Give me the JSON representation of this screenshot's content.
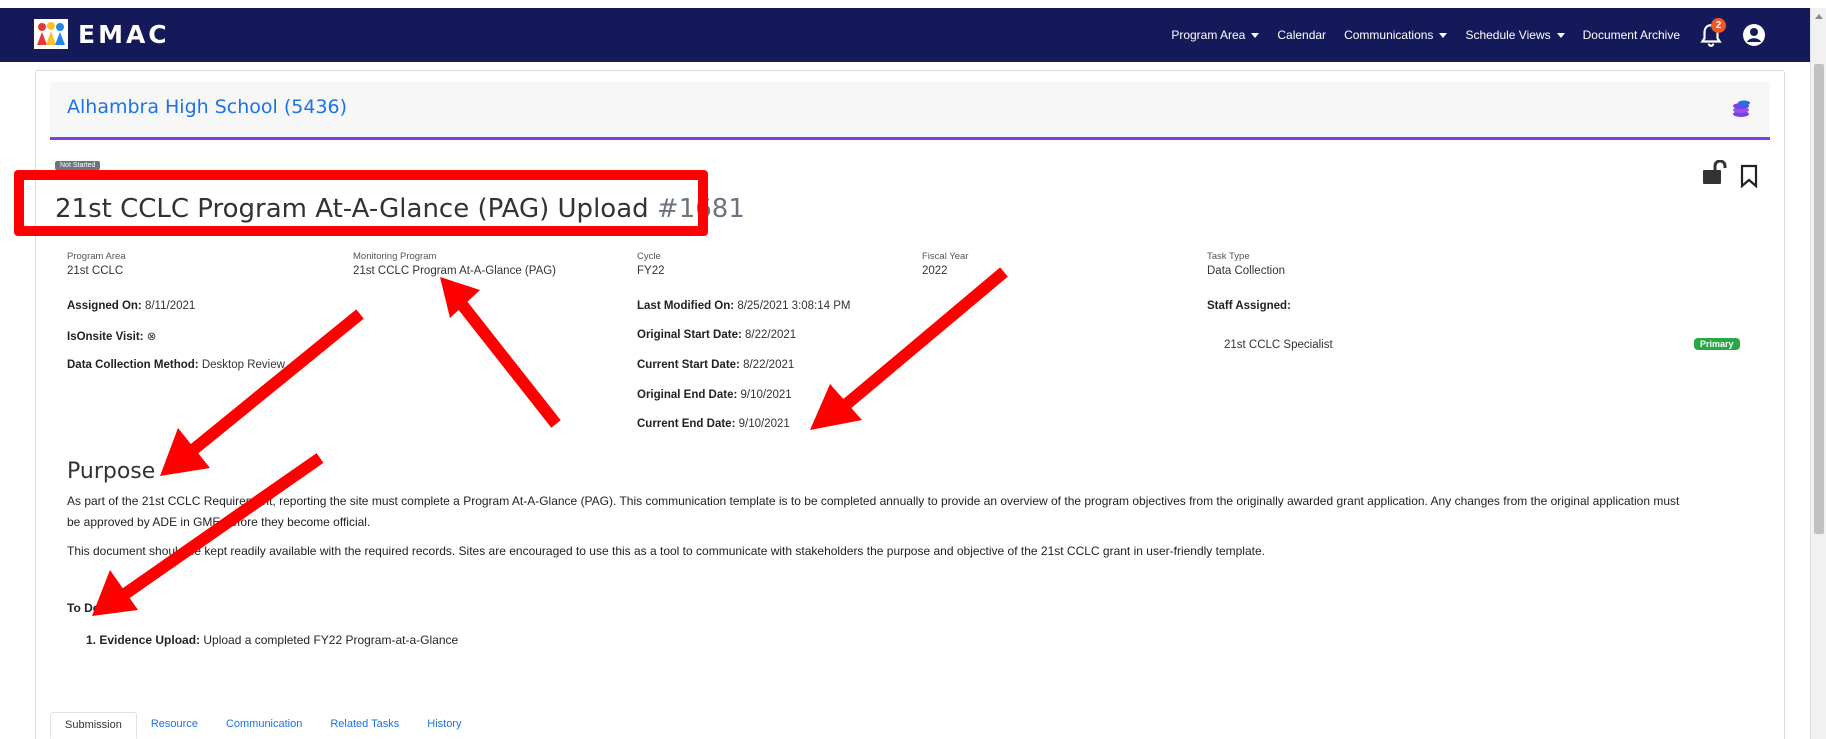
{
  "app": {
    "name": "EMAC"
  },
  "nav": {
    "items": [
      {
        "label": "Program Area",
        "dropdown": true
      },
      {
        "label": "Calendar",
        "dropdown": false
      },
      {
        "label": "Communications",
        "dropdown": true
      },
      {
        "label": "Schedule Views",
        "dropdown": true
      },
      {
        "label": "Document Archive",
        "dropdown": false
      }
    ],
    "notification_count": "2"
  },
  "school": {
    "name": "Alhambra High School (5436)"
  },
  "task": {
    "status": "Not Started",
    "title": "21st CCLC Program At-A-Glance (PAG) Upload",
    "number": "#1681"
  },
  "meta": {
    "program_area_label": "Program Area",
    "program_area": "21st CCLC",
    "monitoring_program_label": "Monitoring Program",
    "monitoring_program": "21st CCLC Program At-A-Glance (PAG)",
    "cycle_label": "Cycle",
    "cycle": "FY22",
    "fiscal_year_label": "Fiscal Year",
    "fiscal_year": "2022",
    "task_type_label": "Task Type",
    "task_type": "Data Collection"
  },
  "details": {
    "assigned_on_label": "Assigned On:",
    "assigned_on": "8/11/2021",
    "onsite_label": "IsOnsite Visit:",
    "onsite_value": "⊗",
    "method_label": "Data Collection Method:",
    "method": "Desktop Review",
    "last_modified_label": "Last Modified On:",
    "last_modified": "8/25/2021 3:08:14 PM",
    "orig_start_label": "Original Start Date:",
    "orig_start": "8/22/2021",
    "cur_start_label": "Current Start Date:",
    "cur_start": "8/22/2021",
    "orig_end_label": "Original End Date:",
    "orig_end": "9/10/2021",
    "cur_end_label": "Current End Date:",
    "cur_end": "9/10/2021",
    "staff_label": "Staff Assigned:",
    "staff_name": "21st CCLC Specialist",
    "staff_badge": "Primary"
  },
  "purpose": {
    "heading": "Purpose",
    "para1_line1": "As part of the 21st CCLC Requirement, reporting the site must complete a Program At-A-Glance (PAG). This communication template is to be completed annually to provide an overview of the program objectives from the originally awarded grant application. Any changes from the original application must",
    "para1_line2": "be approved by ADE in GME before they become official.",
    "para2": "This document should be kept readily available with the required records. Sites are encouraged to use this as a tool to communicate with stakeholders the purpose and objective of the 21st CCLC grant in user-friendly template.",
    "todo_label": "To Do:",
    "todo_item_label": "1. Evidence Upload:",
    "todo_item_text": "Upload a completed FY22 Program-at-a-Glance"
  },
  "tabs": [
    "Submission",
    "Resource",
    "Communication",
    "Related Tasks",
    "History"
  ],
  "colors": {
    "navbar": "#14195a",
    "accent_purple": "#7b3fe4",
    "link_blue": "#1a73e8",
    "annotation_red": "#ff0000",
    "primary_green": "#28a745"
  }
}
